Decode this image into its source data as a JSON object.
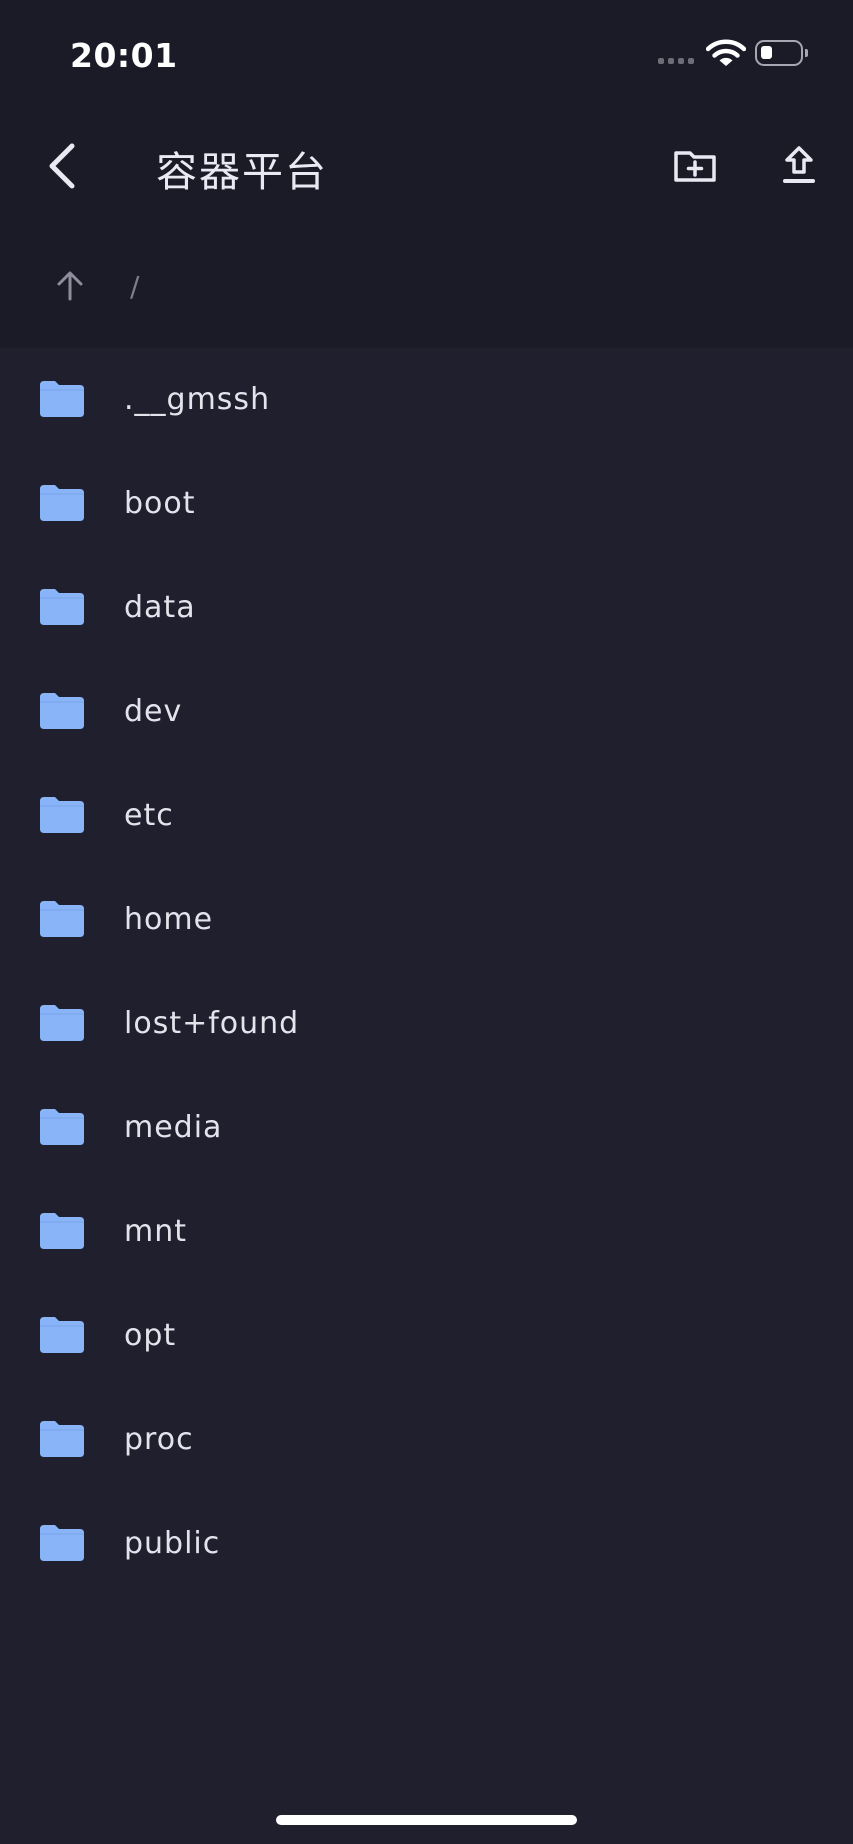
{
  "status_bar": {
    "time": "20:01",
    "battery_level": 0.3
  },
  "header": {
    "title": "容器平台",
    "back_icon": "chevron-left-icon",
    "new_folder_icon": "folder-plus-icon",
    "upload_icon": "upload-icon"
  },
  "path_bar": {
    "up_icon": "arrow-up-icon",
    "current_path": "/"
  },
  "files": [
    {
      "name": ".__gmssh",
      "icon": "folder-icon"
    },
    {
      "name": "boot",
      "icon": "folder-icon"
    },
    {
      "name": "data",
      "icon": "folder-icon"
    },
    {
      "name": "dev",
      "icon": "folder-icon"
    },
    {
      "name": "etc",
      "icon": "folder-icon"
    },
    {
      "name": "home",
      "icon": "folder-icon"
    },
    {
      "name": "lost+found",
      "icon": "folder-icon"
    },
    {
      "name": "media",
      "icon": "folder-icon"
    },
    {
      "name": "mnt",
      "icon": "folder-icon"
    },
    {
      "name": "opt",
      "icon": "folder-icon"
    },
    {
      "name": "proc",
      "icon": "folder-icon"
    },
    {
      "name": "public",
      "icon": "folder-icon"
    }
  ],
  "colors": {
    "background": "#1f1f2d",
    "header_background": "#1b1b28",
    "folder": "#8ab4f8",
    "text": "#e3e3ec",
    "muted": "#7d7d8c"
  }
}
